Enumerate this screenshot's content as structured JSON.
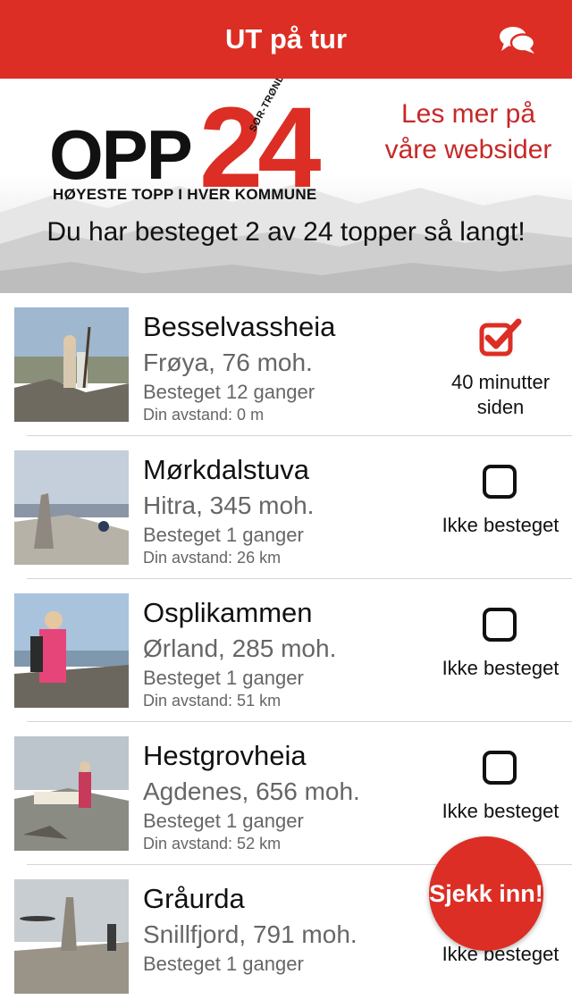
{
  "header": {
    "title": "UT på tur",
    "chat_icon": "chat-bubbles-icon"
  },
  "hero": {
    "logo_main": "OPP",
    "logo_number": "24",
    "logo_region": "SØR-TRØNDELAG",
    "logo_tagline": "HØYESTE TOPP I HVER KOMMUNE",
    "read_more": "Les mer på våre websider",
    "progress": "Du har besteget 2 av 24 topper så langt!"
  },
  "peaks": [
    {
      "name": "Besselvassheia",
      "location": "Frøya, 76 moh.",
      "count": "Besteget 12 ganger",
      "distance": "Din avstand: 0 m",
      "checked": true,
      "status": "40 minutter siden"
    },
    {
      "name": "Mørkdalstuva",
      "location": "Hitra, 345 moh.",
      "count": "Besteget 1 ganger",
      "distance": "Din avstand: 26 km",
      "checked": false,
      "status": "Ikke besteget"
    },
    {
      "name": "Osplikammen",
      "location": "Ørland, 285 moh.",
      "count": "Besteget 1 ganger",
      "distance": "Din avstand: 51 km",
      "checked": false,
      "status": "Ikke besteget"
    },
    {
      "name": "Hestgrovheia",
      "location": "Agdenes, 656 moh.",
      "count": "Besteget 1 ganger",
      "distance": "Din avstand: 52 km",
      "checked": false,
      "status": "Ikke besteget"
    },
    {
      "name": "Gråurda",
      "location": "Snillfjord, 791 moh.",
      "count": "Besteget 1 ganger",
      "distance": "",
      "checked": false,
      "status": "Ikke besteget"
    }
  ],
  "fab": {
    "label": "Sjekk inn!"
  },
  "colors": {
    "accent": "#dc2e24",
    "text": "#111111",
    "muted": "#666666"
  }
}
